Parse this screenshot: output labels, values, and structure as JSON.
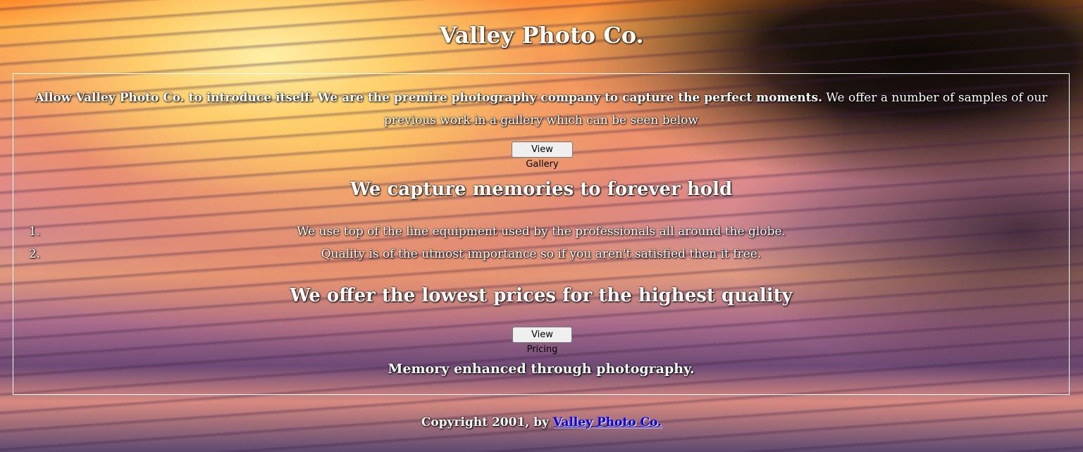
{
  "header": {
    "title": "Valley Photo Co."
  },
  "intro": {
    "bold_text": "Allow Valley Photo Co. to introduce itself. We are the premire photography company to capture the perfect moments.",
    "normal_text": " We offer a number of samples of our previous work in a gallery which can be seen below"
  },
  "buttons": {
    "gallery_label": "View Gallery",
    "pricing_label": "View Pricing"
  },
  "section_memories": {
    "heading": "We capture memories to forever hold",
    "items": [
      {
        "number": "1.",
        "text": "We use top of the line equipment used by the professionals all around the globe."
      },
      {
        "number": "2.",
        "text": "Quality is of the utmost importance so if you aren't satisfied then it free."
      }
    ]
  },
  "section_prices": {
    "heading": "We offer the lowest prices for the highest quality"
  },
  "tagline": "Memory enhanced through photography.",
  "footer": {
    "prefix": "Copyright 2001, by ",
    "link_text": "Valley Photo Co."
  },
  "colors": {
    "text": "#ffffff",
    "link": "#0000ee",
    "button_bg": "#efefef"
  }
}
